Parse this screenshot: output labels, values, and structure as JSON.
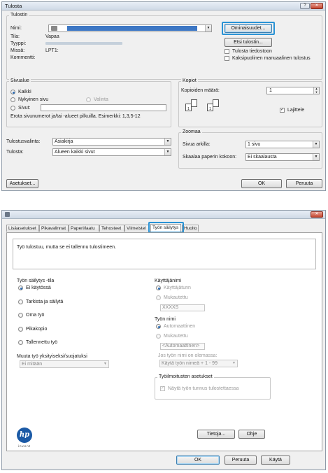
{
  "dialog1": {
    "title": "Tulosta",
    "window_controls": {
      "help": "?",
      "close": "✕"
    },
    "printer_group": {
      "title": "Tulostin",
      "name_label": "Nimi:",
      "status_label": "Tila:",
      "status_value": "Vapaa",
      "type_label": "Tyyppi:",
      "where_label": "Missä:",
      "where_value": "LPT1:",
      "comment_label": "Kommentti:",
      "properties_button": "Ominaisuudet...",
      "find_printer_button": "Etsi tulostin...",
      "print_to_file": "Tulosta tiedostoon",
      "manual_duplex": "Kaksipuolinen manuaalinen tulostus"
    },
    "page_range": {
      "title": "Sivualue",
      "all": "Kaikki",
      "current_page": "Nykyinen sivu",
      "selection": "Valinta",
      "pages": "Sivut:",
      "hint": "Erota sivunumerot ja/tai -alueet pilkuilla. Esimerkki: 1,3,5-12"
    },
    "copies": {
      "title": "Kopiot",
      "count_label": "Kopioiden määrä:",
      "count_value": "1",
      "collate": "Lajittele",
      "collate_checked": true
    },
    "print_what_label": "Tulostusvalinta:",
    "print_what_value": "Asiakirja",
    "print_label": "Tulosta:",
    "print_value": "Alueen kaikki sivut",
    "zoom": {
      "title": "Zoomaa",
      "pages_per_sheet_label": "Sivua arkilla:",
      "pages_per_sheet_value": "1 sivu",
      "scale_label": "Skaalaa paperin kokoon:",
      "scale_value": "Ei skaalausta"
    },
    "options_button": "Asetukset...",
    "ok_button": "OK",
    "cancel_button": "Peruuta"
  },
  "dialog2": {
    "close": "✕",
    "tabs": [
      "Lisäasetukset",
      "Pikavalinnat",
      "Paperi/laatu",
      "Tehosteet",
      "Viimeistel",
      "Työn säilytys",
      "Huolto"
    ],
    "active_tab_index": 5,
    "description": "Työ tulostuu, mutta se ei tallennu tulostimeen.",
    "storage_mode": {
      "title": "Työn säilytys -tila",
      "options": [
        "Ei käytössä",
        "Tarkista ja säilytä",
        "Oma työ",
        "Pikakopio",
        "Tallennettu työ"
      ],
      "selected_index": 0
    },
    "make_private_label": "Muuta työ yksityiseksi/suojatuksi",
    "make_private_value": "Ei mitään",
    "user_name": {
      "title": "Käyttäjänimi",
      "options": [
        "Käyttäjätunn",
        "Mukautettu"
      ],
      "value": "XXXXS"
    },
    "job_name": {
      "title": "Työn nimi",
      "options": [
        "Automaattinen",
        "Mukautettu"
      ],
      "value": "<Automaattinen>",
      "exists_label": "Jos työn nimi on olemassa:",
      "exists_value": "Käytä työn nimeä + 1 - 99"
    },
    "notify": {
      "title": "Työilmoitusten asetukset",
      "show_id": "Näytä työn tunnus tulostettaessa"
    },
    "logo_text": "hp",
    "logo_tagline": "invent",
    "about_button": "Tietoja...",
    "help_button": "Ohje",
    "ok_button": "OK",
    "cancel_button": "Peruuta",
    "apply_button": "Käytä"
  }
}
